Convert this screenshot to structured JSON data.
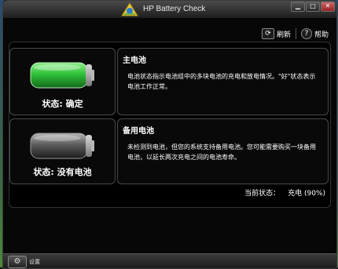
{
  "window": {
    "title": "HP Battery Check",
    "controls": [
      "minimize",
      "maximize",
      "close"
    ]
  },
  "toolbar": {
    "refresh_label": "刷新",
    "help_label": "帮助"
  },
  "main_battery": {
    "status": "状态: 确定",
    "title": "主电池",
    "body": "电池状态指示电池组中的多块电池的充电和放电情况。\"好\"状态表示电池工作正常。",
    "charge_color": "#2fc23a"
  },
  "backup_battery": {
    "status": "状态: 没有电池",
    "title": "备用电池",
    "body": "未检测到电池，但您的系统支持备用电池。您可能需要购买一块备用电池，以延长两次充电之间的电池寿命。",
    "charge_color": "#7a7a7a"
  },
  "current_state": {
    "label": "当前状态：",
    "value": "充电 (90%)"
  },
  "statusbar": {
    "settings_label": "设置"
  }
}
